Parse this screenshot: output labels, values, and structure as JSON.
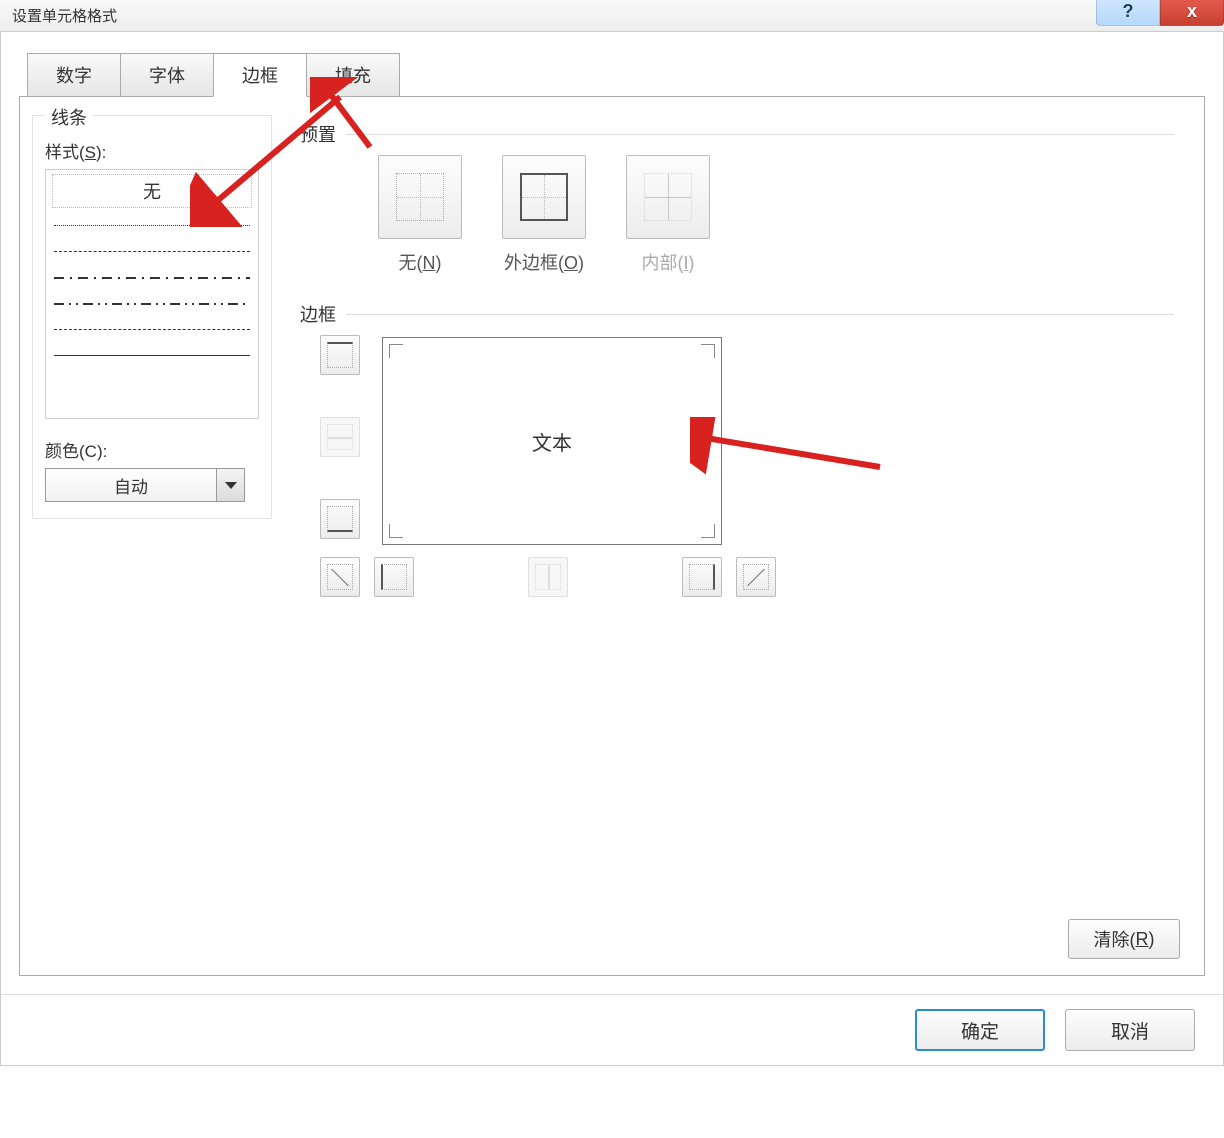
{
  "titlebar": {
    "title": "设置单元格格式"
  },
  "tabs": {
    "number": "数字",
    "font": "字体",
    "border": "边框",
    "fill": "填充"
  },
  "line_panel": {
    "group_title": "线条",
    "style_label_prefix": "样式(",
    "style_label_key": "S",
    "style_label_suffix": "):",
    "none_option": "无",
    "color_label_prefix": "颜色(",
    "color_label_key": "C",
    "color_label_suffix": "):",
    "color_value": "自动"
  },
  "presets": {
    "section_title": "预置",
    "none_prefix": "无(",
    "none_key": "N",
    "none_suffix": ")",
    "outer_prefix": "外边框(",
    "outer_key": "O",
    "outer_suffix": ")",
    "inner_prefix": "内部(",
    "inner_key": "I",
    "inner_suffix": ")"
  },
  "border_section": {
    "section_title": "边框",
    "preview_text": "文本"
  },
  "buttons": {
    "clear_prefix": "清除(",
    "clear_key": "R",
    "clear_suffix": ")",
    "ok": "确定",
    "cancel": "取消"
  }
}
